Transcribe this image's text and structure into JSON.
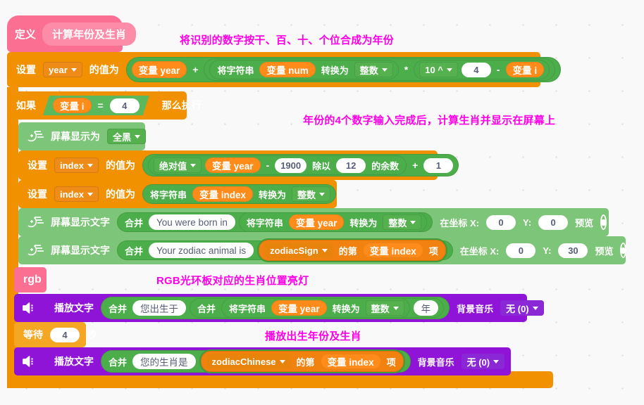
{
  "editor": {
    "kind": "block-programming-canvas",
    "background": "#f9f9f9",
    "comment_color": "#ff00e6"
  },
  "define_block": {
    "keyword": "定义",
    "procedure_name": "计算年份及生肖",
    "color": "#fb6f92"
  },
  "set_year_block": {
    "keyword": "设置",
    "variable": "year",
    "middle": "的值为",
    "operand_a": "变量 year",
    "operator": "+",
    "convert_label": "将字符串",
    "convert_value": "变量 num",
    "convert_to_label": "转换为",
    "convert_type": "整数",
    "mul": "*",
    "pow_label": "10 ^",
    "exponent": "4",
    "minus": "-",
    "sub_var": "变量 i",
    "color": "#f29100"
  },
  "if_block": {
    "keyword": "如果",
    "condition_left": "变量 i",
    "condition_op": "=",
    "condition_right": "4",
    "then": "那么执行",
    "color": "#f29100"
  },
  "screen_fill_block": {
    "label": "屏幕显示为",
    "value": "全黑",
    "icon": "led-matrix-icon",
    "color": "#7dc578"
  },
  "set_index_mod_block": {
    "keyword": "设置",
    "variable": "index",
    "middle": "的值为",
    "abs_label": "绝对值",
    "operand": "变量 year",
    "minus": "-",
    "minus_value": "1900",
    "mod_label": "除以",
    "mod_value": "12",
    "mod_suffix": "的余数",
    "plus": "+",
    "plus_value": "1",
    "color": "#f29100"
  },
  "set_index_int_block": {
    "keyword": "设置",
    "variable": "index",
    "middle": "的值为",
    "convert_label": "将字符串",
    "convert_value": "变量 index",
    "convert_to_label": "转换为",
    "convert_type": "整数",
    "color": "#f29100"
  },
  "display_text_year_block": {
    "label": "屏幕显示文字",
    "join_label": "合并",
    "text_value": "You were born in",
    "convert_label": "将字符串",
    "convert_value": "变量 year",
    "convert_to_label": "转换为",
    "convert_type": "整数",
    "coord_label": "在坐标 X:",
    "x": "0",
    "y_label": "Y:",
    "y": "0",
    "preview_label": "预览",
    "icon": "led-matrix-icon",
    "eye_icon": "eye-icon",
    "color": "#7dc578"
  },
  "display_text_zodiac_block": {
    "label": "屏幕显示文字",
    "join_label": "合并",
    "text_value": "Your zodiac animal is",
    "list_name": "zodiacSign",
    "item_label": "的第",
    "item_index": "变量 index",
    "item_suffix": "项",
    "coord_label": "在坐标 X:",
    "x": "0",
    "y_label": "Y:",
    "y": "30",
    "preview_label": "预览",
    "icon": "led-matrix-icon",
    "eye_icon": "eye-icon",
    "color": "#7dc578"
  },
  "rgb_block": {
    "label": "rgb",
    "color": "#fb6f92"
  },
  "speak_year_block": {
    "label": "播放文字",
    "join1_label": "合并",
    "text1": "您出生于",
    "join2_label": "合并",
    "convert_label": "将字符串",
    "convert_value": "变量 year",
    "convert_to_label": "转换为",
    "convert_type": "整数",
    "text2": "年",
    "bgm_label": "背景音乐",
    "bgm_value": "无 (0)",
    "icon": "speaker-icon",
    "color": "#9013d8"
  },
  "wait_block": {
    "keyword": "等待",
    "seconds": "4",
    "unit": "秒",
    "color": "#f5a623"
  },
  "speak_zodiac_block": {
    "label": "播放文字",
    "join_label": "合并",
    "text1": "您的生肖是",
    "list_name": "zodiacChinese",
    "item_label": "的第",
    "item_index": "变量 index",
    "item_suffix": "项",
    "bgm_label": "背景音乐",
    "bgm_value": "无 (0)",
    "icon": "speaker-icon",
    "color": "#9013d8"
  },
  "comments": [
    {
      "text": "将识别的数字按干、百、十、个位合成为年份"
    },
    {
      "text": "年份的4个数字输入完成后，计算生肖并显示在屏幕上"
    },
    {
      "text": "RGB光环板对应的生肖位置亮灯"
    },
    {
      "text": "播放出生年份及生肖"
    }
  ]
}
